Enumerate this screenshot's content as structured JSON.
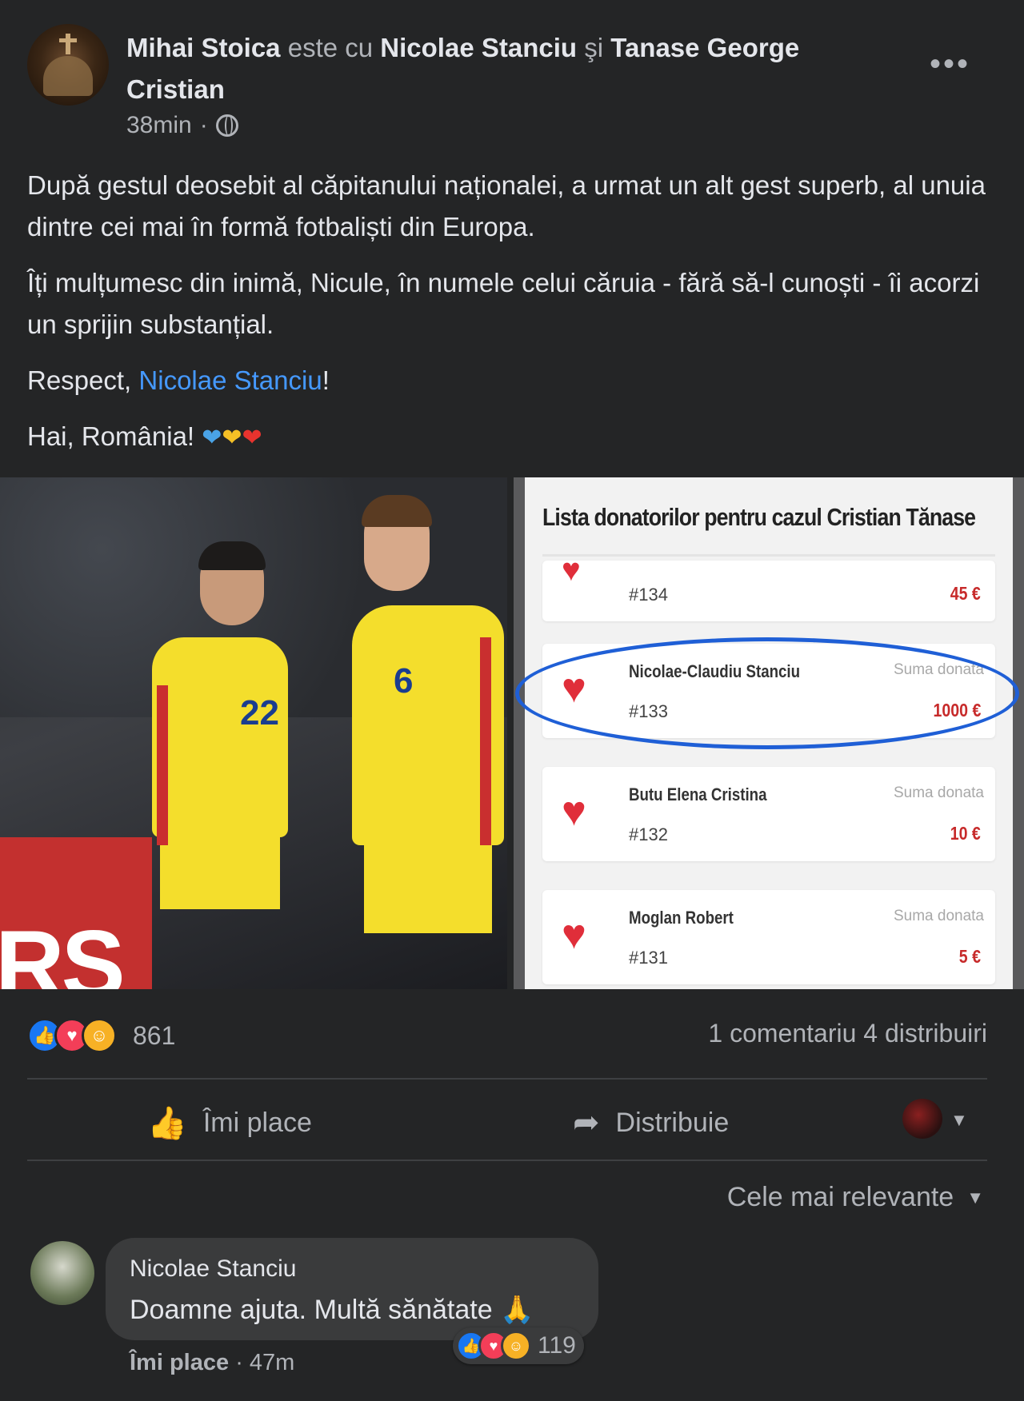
{
  "post": {
    "author": "Mihai Stoica",
    "with_word": "este cu",
    "tagged1": "Nicolae Stanciu",
    "and_word": "şi",
    "tagged2": "Tanase George Cristian",
    "time": "38min",
    "separator": "·",
    "more": "•••",
    "para1": "După  gestul deosebit al căpitanului naționalei, a urmat un alt gest superb, al unuia dintre cei mai în formă fotbaliști din Europa.",
    "para2": "Îți mulțumesc din inimă, Nicule, în numele celui căruia - fără să-l cunoști - îi acorzi un sprijin substanțial.",
    "para3_before": "Respect, ",
    "para3_link": "Nicolae Stanciu",
    "para3_after": "!",
    "para4": "Hai, România!",
    "emoji_hearts": [
      "❤",
      "❤",
      "❤"
    ]
  },
  "photo": {
    "banner_text": "RS",
    "number_left": "22",
    "number_right": "6"
  },
  "screenshot": {
    "title": "Lista donatorilor pentru cazul Cristian Tănase",
    "donations": [
      {
        "name": "",
        "id": "#134",
        "label": "",
        "sum": "45 €"
      },
      {
        "name": "Nicolae-Claudiu Stanciu",
        "id": "#133",
        "label": "Suma donata",
        "sum": "1000 €"
      },
      {
        "name": "Butu Elena Cristina",
        "id": "#132",
        "label": "Suma donata",
        "sum": "10 €"
      },
      {
        "name": "Moglan Robert",
        "id": "#131",
        "label": "Suma donata",
        "sum": "5 €"
      }
    ]
  },
  "stats": {
    "reactions": "861",
    "comments": "1 comentariu",
    "shares": "4 distribuiri"
  },
  "actions": {
    "like": "Îmi place",
    "share": "Distribuie"
  },
  "sort": {
    "label": "Cele mai relevante"
  },
  "comment": {
    "author": "Nicolae Stanciu",
    "text": "Doamne ajuta. Multă sănătate",
    "emoji": "🙏",
    "reactions": "119",
    "like": "Îmi place",
    "time": "47m"
  }
}
